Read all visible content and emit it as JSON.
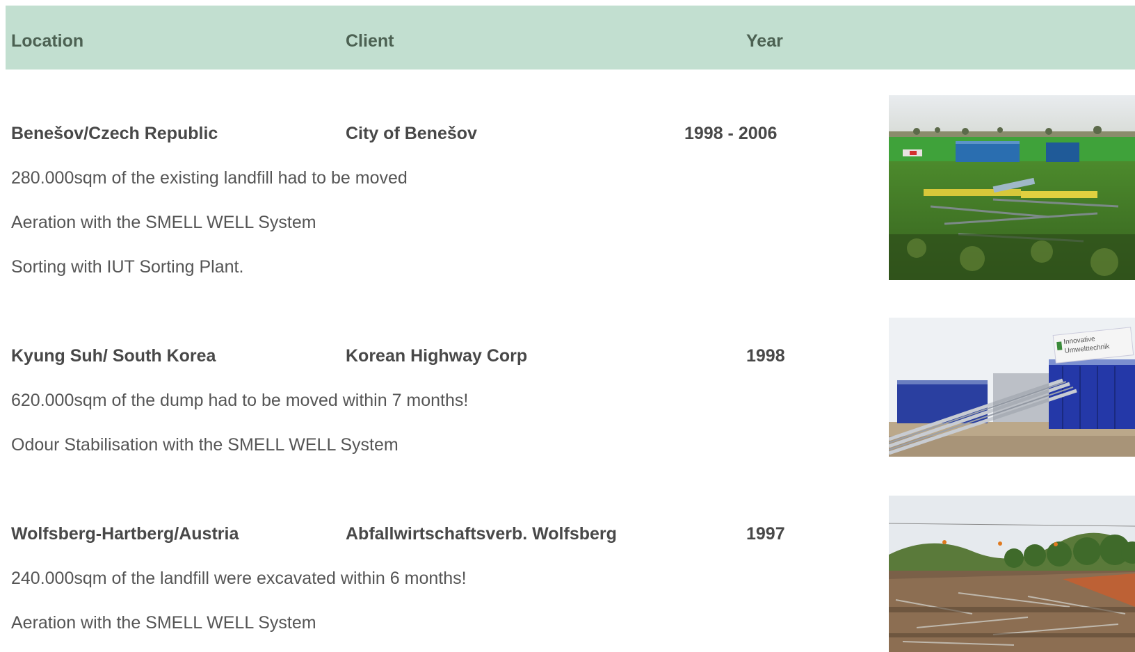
{
  "header": {
    "location": "Location",
    "client": "Client",
    "year": "Year"
  },
  "projects": [
    {
      "location": "Benešov/Czech Republic",
      "client": "City of Benešov",
      "year": "1998 - 2006",
      "descriptions": [
        "280.000sqm of the existing landfill had to be moved",
        "Aeration with the SMELL WELL System",
        "Sorting with IUT Sorting Plant."
      ]
    },
    {
      "location": "Kyung Suh/ South Korea",
      "client": "Korean Highway Corp",
      "year": "1998",
      "descriptions": [
        "620.000sqm of the dump had to be moved within 7 months!",
        "Odour Stabilisation with the SMELL WELL System"
      ],
      "photo_sign_text": [
        "Innovative",
        "Umwelttechnik"
      ]
    },
    {
      "location": "Wolfsberg-Hartberg/Austria",
      "client": "Abfallwirtschaftsverb. Wolfsberg",
      "year": "1997",
      "descriptions": [
        "240.000sqm of the landfill were excavated within 6 months!",
        "Aeration with the SMELL WELL System"
      ]
    }
  ],
  "colors": {
    "header_bg": "#c2dfd0",
    "header_text": "#4c6152",
    "bold_text": "#484848",
    "body_text": "#555555"
  }
}
